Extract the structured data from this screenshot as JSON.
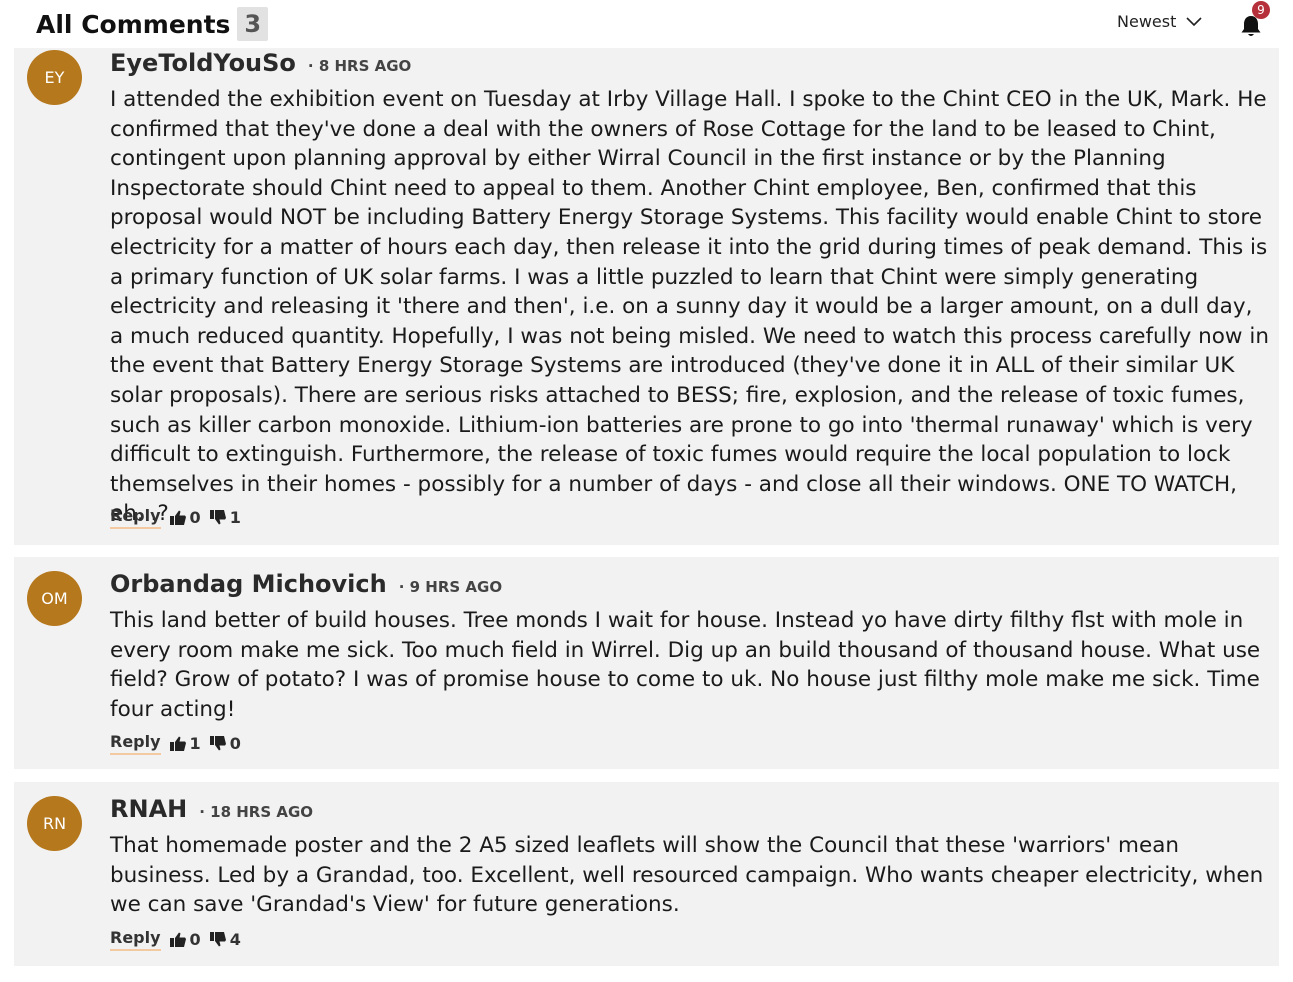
{
  "header": {
    "title": "All Comments",
    "count": "3",
    "sort_label": "Newest",
    "notification_count": "9"
  },
  "colors": {
    "avatar": "#b5781d",
    "badge": "#b5303a",
    "card": "#f2f2f2",
    "reply_underline": "#f2c9a0"
  },
  "comments": [
    {
      "initials": "EY",
      "author": "EyeToldYouSo",
      "time": "· 8 HRS AGO",
      "body": "I attended the exhibition event on Tuesday at Irby Village Hall. I spoke to the Chint CEO in the UK, Mark. He confirmed that they've done a deal with the owners of Rose Cottage for the land to be leased to Chint, contingent upon planning approval by either Wirral Council in the first instance or by the Planning Inspectorate should Chint need to appeal to them. Another Chint employee, Ben, confirmed that this proposal would NOT be including Battery Energy Storage Systems. This facility would enable Chint to store electricity for a matter of hours each day, then release it into the grid during times of peak demand. This is a primary function of UK solar farms. I was a little puzzled to learn that Chint were simply generating electricity and releasing it 'there and then', i.e. on a sunny day it would be a larger amount, on a dull day, a much reduced quantity. Hopefully, I was not being misled. We need to watch this process carefully now in the event that Battery Energy Storage Systems are introduced (they've done it in ALL of their similar UK solar proposals). There are serious risks attached to BESS; fire, explosion, and the release of toxic fumes, such as killer carbon monoxide. Lithium-ion batteries are prone to go into 'thermal runaway' which is very difficult to extinguish. Furthermore, the release of toxic fumes would require the local population to lock themselves in their homes - possibly for a number of days - and close all their windows. ONE TO WATCH, eh...?",
      "reply_label": "Reply",
      "likes": "0",
      "dislikes": "1"
    },
    {
      "initials": "OM",
      "author": "Orbandag Michovich",
      "time": "· 9 HRS AGO",
      "body": "This land better of build houses. Tree monds I wait for house. Instead yo have dirty filthy flst with mole in every room make me sick. Too much field in Wirrel. Dig up an build thousand of thousand house. What use field? Grow of potato? I was of promise house to come to uk. No house just filthy mole make me sick. Time four acting!",
      "reply_label": "Reply",
      "likes": "1",
      "dislikes": "0"
    },
    {
      "initials": "RN",
      "author": "RNAH",
      "time": "· 18 HRS AGO",
      "body": "That homemade poster and the 2 A5 sized leaflets will show the Council that these 'warriors' mean business. Led by a Grandad, too. Excellent, well resourced campaign. Who wants cheaper electricity, when we can save 'Grandad's View' for future generations.",
      "reply_label": "Reply",
      "likes": "0",
      "dislikes": "4"
    }
  ]
}
